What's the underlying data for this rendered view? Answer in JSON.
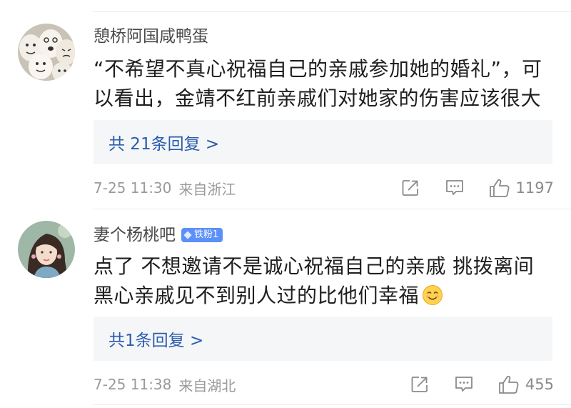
{
  "comments": [
    {
      "username": "憩桥阿国咸鸭蛋",
      "text": "“不希望不真心祝福自己的亲戚参加她的婚礼”，可以看出，金靖不红前亲戚们对她家的伤害应该很大",
      "replies": "共 21条回复 >",
      "time": "7-25 11:30",
      "location": "来自浙江",
      "likes": "1197",
      "avatar_icon": "egg-faces-avatar"
    },
    {
      "username": "妻个杨桃吧",
      "badge": "铁粉1",
      "badge_color": "#5b8ff9",
      "text": "点了 不想邀请不是诚心祝福自己的亲戚 挑拨离间黑心亲戚见不到别人过的比他们幸福",
      "emoji": "smiling-face-emoji",
      "replies": "共1条回复 >",
      "time": "7-25 11:38",
      "location": "来自湖北",
      "likes": "455",
      "avatar_icon": "woman-portrait-avatar"
    }
  ],
  "icons": {
    "share": "share-icon",
    "comment": "comment-icon",
    "like": "thumbs-up-icon"
  },
  "colors": {
    "link": "#2a5dad",
    "reply_bg": "#f5f6f8",
    "meta": "#9a9a9a"
  }
}
